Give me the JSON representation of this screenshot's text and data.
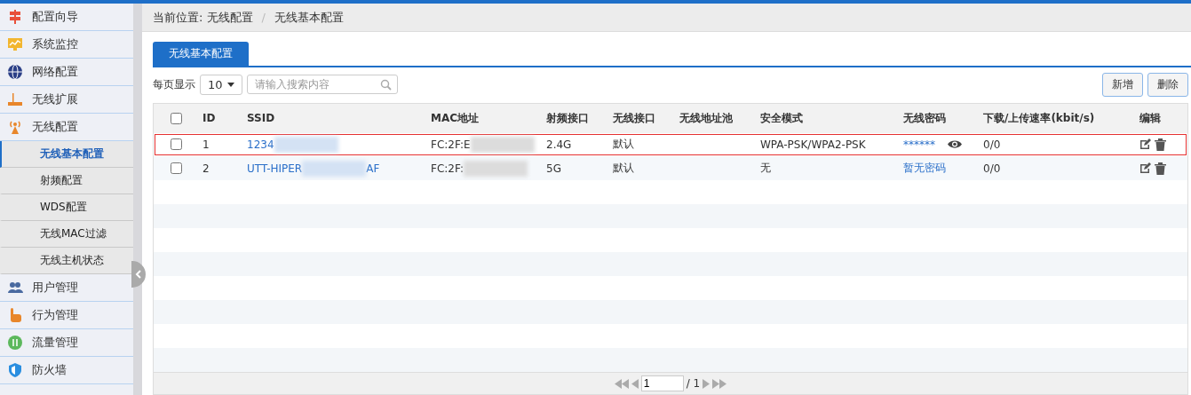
{
  "sidebar": {
    "items": [
      {
        "label": "配置向导",
        "selected": false
      },
      {
        "label": "系统监控",
        "selected": false
      },
      {
        "label": "网络配置",
        "selected": false
      },
      {
        "label": "无线扩展",
        "selected": false
      },
      {
        "label": "无线配置",
        "selected": false,
        "expanded": true,
        "children": [
          {
            "label": "无线基本配置",
            "selected": true
          },
          {
            "label": "射频配置",
            "selected": false
          },
          {
            "label": "WDS配置",
            "selected": false
          },
          {
            "label": "无线MAC过滤",
            "selected": false
          },
          {
            "label": "无线主机状态",
            "selected": false
          }
        ]
      },
      {
        "label": "用户管理",
        "selected": false
      },
      {
        "label": "行为管理",
        "selected": false
      },
      {
        "label": "流量管理",
        "selected": false
      },
      {
        "label": "防火墙",
        "selected": false
      }
    ]
  },
  "breadcrumb": {
    "label": "当前位置: 无线配置",
    "separator": "/",
    "current": "无线基本配置"
  },
  "tabs": [
    {
      "label": "无线基本配置",
      "selected": true
    }
  ],
  "toolbar": {
    "page_size_label": "每页显示",
    "page_size": "10",
    "search_placeholder": "请输入搜索内容",
    "buttons": [
      "新增",
      "删除"
    ]
  },
  "table": {
    "select_all_checked": false,
    "columns": [
      "ID",
      "SSID",
      "MAC地址",
      "射频接口",
      "无线接口",
      "无线地址池",
      "安全模式",
      "无线密码",
      "下载/上传速率(kbit/s)",
      "编辑"
    ],
    "rows": [
      {
        "checked": false,
        "highlighted": true,
        "id": "1",
        "ssid": "1234",
        "mac": "FC:2F:E",
        "band": "2.4G",
        "iface": "默认",
        "security": "WPA-PSK/WPA2-PSK",
        "password": "******",
        "has_password": true,
        "rate": "0/0"
      },
      {
        "checked": false,
        "highlighted": false,
        "id": "2",
        "ssid": "UTT-HIPER",
        "ssid_end": "AF",
        "mac": "FC:2F:",
        "band": "5G",
        "iface": "默认",
        "security": "无",
        "password": "暂无密码",
        "has_password": false,
        "rate": "0/0"
      }
    ]
  },
  "pagination": {
    "page": "1",
    "total": "/ 1"
  }
}
